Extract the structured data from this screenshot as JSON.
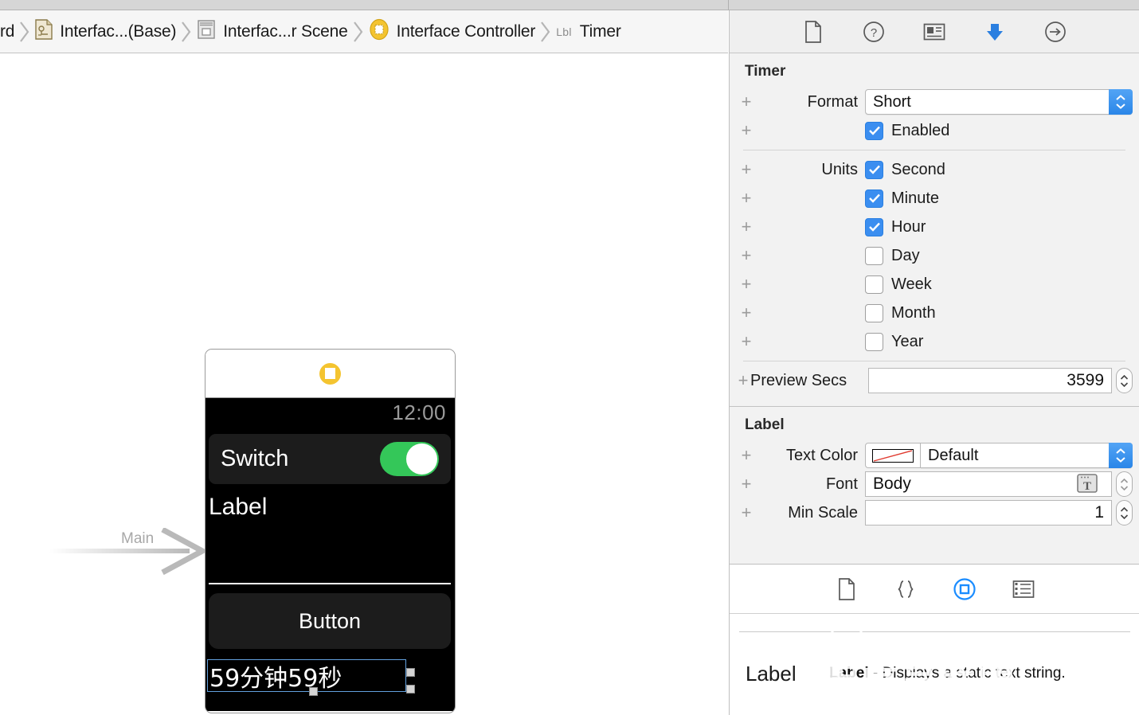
{
  "breadcrumb": {
    "items": [
      {
        "label": "rd",
        "icon": "truncated-storyboard-crumb",
        "truncated": true
      },
      {
        "label": "Interfac...(Base)",
        "icon": "storyboard-file-icon"
      },
      {
        "label": "Interfac...r Scene",
        "icon": "scene-icon"
      },
      {
        "label": "Interface Controller",
        "icon": "interface-controller-icon"
      },
      {
        "label": "Timer",
        "icon": "lbl-badge",
        "badge": "Lbl"
      }
    ]
  },
  "canvas": {
    "entry_point_label": "Main",
    "device": {
      "title_badge": "interface-controller-badge",
      "status_time": "12:00",
      "rows": [
        {
          "type": "switch",
          "label": "Switch",
          "value": "on"
        },
        {
          "type": "label",
          "label": "Label"
        },
        {
          "type": "button",
          "label": "Button"
        },
        {
          "type": "timer",
          "label": "59分钟59秒",
          "selected": true
        }
      ]
    }
  },
  "inspector": {
    "tabs": [
      {
        "name": "file-inspector",
        "icon": "file-icon",
        "selected": false
      },
      {
        "name": "quick-help-inspector",
        "icon": "question-circle-icon",
        "selected": false
      },
      {
        "name": "identity-inspector",
        "icon": "identity-card-icon",
        "selected": false
      },
      {
        "name": "attributes-inspector",
        "icon": "down-arrow-icon",
        "selected": true
      },
      {
        "name": "connections-inspector",
        "icon": "arrow-circle-icon",
        "selected": false
      }
    ],
    "sections": [
      {
        "title": "Timer",
        "format": {
          "label": "Format",
          "value": "Short"
        },
        "enabled": {
          "label": "Enabled",
          "checked": true
        },
        "units_label": "Units",
        "units": [
          {
            "label": "Second",
            "checked": true
          },
          {
            "label": "Minute",
            "checked": true
          },
          {
            "label": "Hour",
            "checked": true
          },
          {
            "label": "Day",
            "checked": false
          },
          {
            "label": "Week",
            "checked": false
          },
          {
            "label": "Month",
            "checked": false
          },
          {
            "label": "Year",
            "checked": false
          }
        ],
        "preview_secs": {
          "label": "Preview Secs",
          "value": "3599"
        }
      },
      {
        "title": "Label",
        "text_color": {
          "label": "Text Color",
          "value": "Default",
          "swatch": "no-color-red-slash"
        },
        "font": {
          "label": "Font",
          "value": "Body"
        },
        "min_scale": {
          "label": "Min Scale",
          "value": "1"
        }
      }
    ]
  },
  "library": {
    "tabs": [
      {
        "name": "file-template-library",
        "icon": "file-icon",
        "selected": false
      },
      {
        "name": "code-snippet-library",
        "icon": "braces-icon",
        "selected": false
      },
      {
        "name": "object-library",
        "icon": "circle-square-icon",
        "selected": true
      },
      {
        "name": "media-library",
        "icon": "media-icon",
        "selected": false
      }
    ],
    "items": [
      {
        "preview": "Label",
        "name": "Label",
        "description": " - Displays a static text string."
      }
    ],
    "watermark": "程序员联盟"
  },
  "colors": {
    "accent_blue": "#3b8ef0",
    "toggle_green": "#34c759",
    "badge_yellow": "#f4c430",
    "selection_blue": "#62a0dd",
    "panel_gray": "#f2f2f2"
  }
}
